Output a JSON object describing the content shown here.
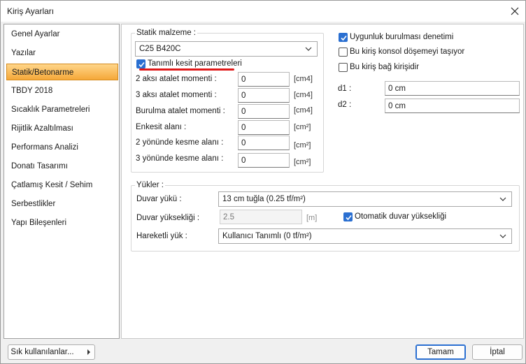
{
  "window": {
    "title": "Kiriş Ayarları"
  },
  "sidebar": {
    "items": [
      {
        "label": "Genel Ayarlar"
      },
      {
        "label": "Yazılar"
      },
      {
        "label": "Statik/Betonarme"
      },
      {
        "label": "TBDY 2018"
      },
      {
        "label": "Sıcaklık Parametreleri"
      },
      {
        "label": "Rijitlik Azaltılması"
      },
      {
        "label": "Performans Analizi"
      },
      {
        "label": "Donatı Tasarımı"
      },
      {
        "label": "Çatlamış Kesit / Sehim"
      },
      {
        "label": "Serbestlikler"
      },
      {
        "label": "Yapı Bileşenleri"
      }
    ],
    "active_index": 2
  },
  "static": {
    "group_label": "Statik malzeme :",
    "material": "C25 B420C",
    "defined_section_label": "Tanımlı kesit parametreleri",
    "defined_section_checked": true,
    "rows": [
      {
        "label": "2 aksı atalet momenti :",
        "value": "0",
        "unit": "[cm4]"
      },
      {
        "label": "3 aksı atalet momenti :",
        "value": "0",
        "unit": "[cm4]"
      },
      {
        "label": "Burulma atalet momenti :",
        "value": "0",
        "unit": "[cm4]"
      },
      {
        "label": "Enkesit alanı :",
        "value": "0",
        "unit": "[cm²]"
      },
      {
        "label": "2 yönünde kesme alanı :",
        "value": "0",
        "unit": "[cm²]"
      },
      {
        "label": "3 yönünde kesme alanı :",
        "value": "0",
        "unit": "[cm²]"
      }
    ]
  },
  "options": {
    "torsion_check": {
      "label": "Uygunluk burulması denetimi",
      "checked": true
    },
    "cantilever": {
      "label": "Bu kiriş konsol döşemeyi taşıyor",
      "checked": false
    },
    "tie_beam": {
      "label": "Bu kiriş bağ kirişidir",
      "checked": false
    },
    "d1": {
      "label": "d1 :",
      "value": "0 cm"
    },
    "d2": {
      "label": "d2 :",
      "value": "0 cm"
    }
  },
  "loads": {
    "group_label": "Yükler :",
    "wall_load_label": "Duvar yükü :",
    "wall_load_value": "13 cm tuğla (0.25 tf/m²)",
    "wall_height_label": "Duvar yüksekliği :",
    "wall_height_value": "2.5",
    "wall_height_unit": "[m]",
    "auto_height_label": "Otomatik duvar yüksekliği",
    "auto_height_checked": true,
    "live_load_label": "Hareketli yük :",
    "live_load_value": "Kullanıcı Tanımlı (0 tf/m²)"
  },
  "footer": {
    "favorites_label": "Sık kullanılanlar...",
    "ok_label": "Tamam",
    "cancel_label": "İptal"
  },
  "colors": {
    "accent": "#2a6fd1",
    "active_item": "#f5a838",
    "underline": "#e01818"
  }
}
